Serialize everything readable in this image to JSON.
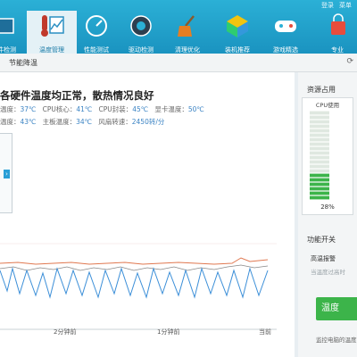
{
  "window_controls": [
    "登录",
    "菜单"
  ],
  "toolbar": {
    "items": [
      {
        "label": "硬件检测",
        "icon": "hardware-icon"
      },
      {
        "label": "温度管理",
        "icon": "thermometer-icon",
        "active": true
      },
      {
        "label": "性能测试",
        "icon": "speedometer-icon"
      },
      {
        "label": "驱动检测",
        "icon": "driver-icon"
      },
      {
        "label": "清理优化",
        "icon": "broom-icon"
      },
      {
        "label": "装机推荐",
        "icon": "package-icon"
      },
      {
        "label": "游戏精选",
        "icon": "gamepad-icon"
      },
      {
        "label": "专业",
        "icon": "shopping-bag-icon"
      }
    ]
  },
  "subbar": {
    "tab": "节能降温"
  },
  "main": {
    "headline": "各硬件温度均正常，散热情况良好",
    "temps": {
      "l1": "温度：",
      "v1": "37℃",
      "l2": "CPU核心：",
      "v2": "41℃",
      "l3": "CPU封装：",
      "v3": "45℃",
      "l4": "显卡温度：",
      "v4": "50℃",
      "l5": "温度：",
      "v5": "43℃",
      "l6": "主板温度：",
      "v6": "34℃",
      "l7": "风扇转速：",
      "v7": "2450转/分"
    },
    "xlabels": [
      "2分钟前",
      "1分钟前",
      "当前"
    ]
  },
  "side": {
    "title": "资源占用",
    "cpu_caption": "CPU使用",
    "cpu_percent": "28%",
    "cpu_level": 0.28,
    "switch_title": "功能开关",
    "switch_item": "高温报警",
    "switch_desc": "当温度过高时",
    "cta": "温度",
    "footer": "监控电脑的温度"
  },
  "colors": {
    "accent": "#2bb0d6",
    "value_blue": "#3c84c4",
    "green": "#3cb44a",
    "line_orange": "#e07850",
    "line_blue": "#3c8fd8"
  }
}
